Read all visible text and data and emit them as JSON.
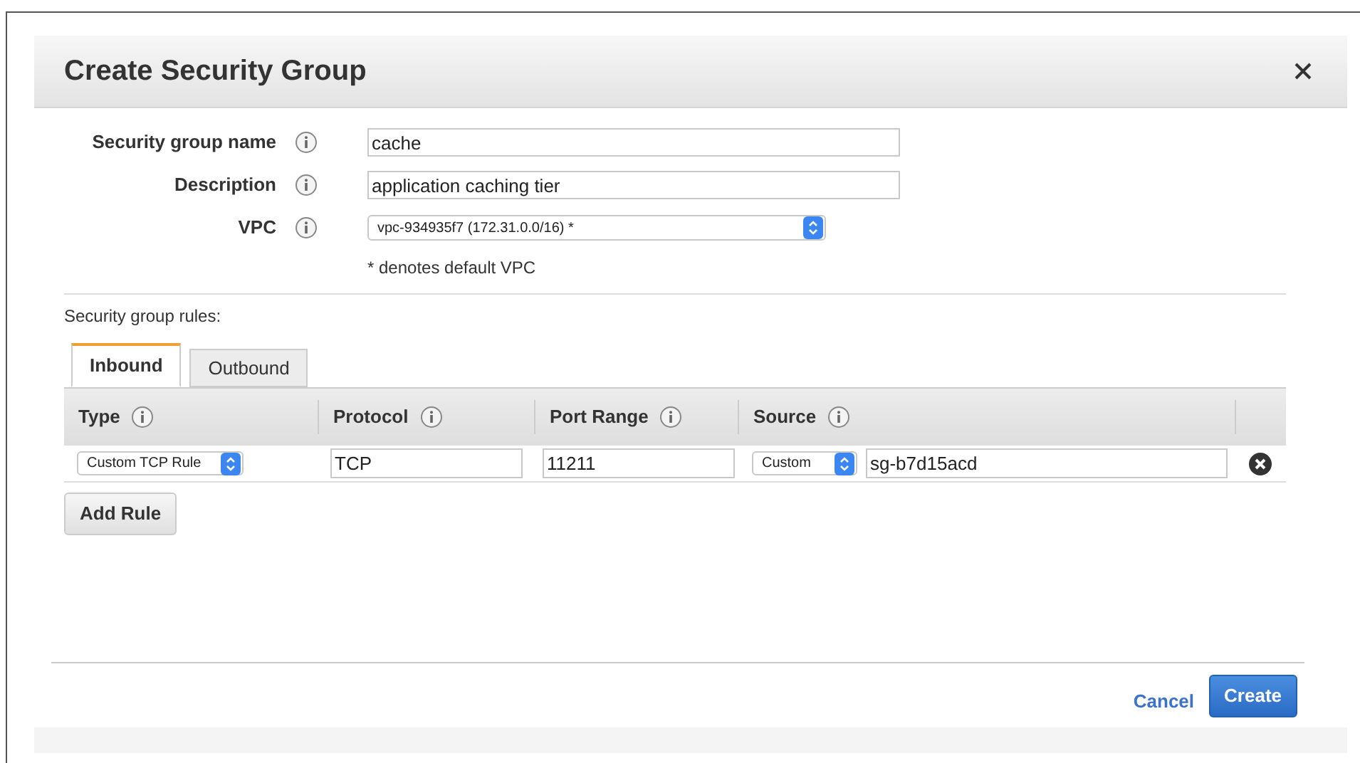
{
  "dialog": {
    "title": "Create Security Group",
    "fields": [
      {
        "label": "Security group name",
        "kind": "text",
        "value": "cache"
      },
      {
        "label": "Description",
        "kind": "text",
        "value": "application caching tier"
      },
      {
        "label": "VPC",
        "kind": "select",
        "value": "vpc-934935f7 (172.31.0.0/16) *"
      }
    ],
    "vpc_note": "* denotes default VPC",
    "rules_label": "Security group rules:",
    "tabs": [
      {
        "label": "Inbound",
        "selected": true
      },
      {
        "label": "Outbound",
        "selected": false
      }
    ],
    "table": {
      "columns": [
        "Type",
        "Protocol",
        "Port Range",
        "Source"
      ],
      "rows": [
        {
          "type": "Custom TCP Rule",
          "protocol": "TCP",
          "port_range": "11211",
          "source_type": "Custom",
          "source": "sg-b7d15acd"
        }
      ]
    },
    "add_button": "Add Rule",
    "cancel": "Cancel",
    "create": "Create"
  }
}
